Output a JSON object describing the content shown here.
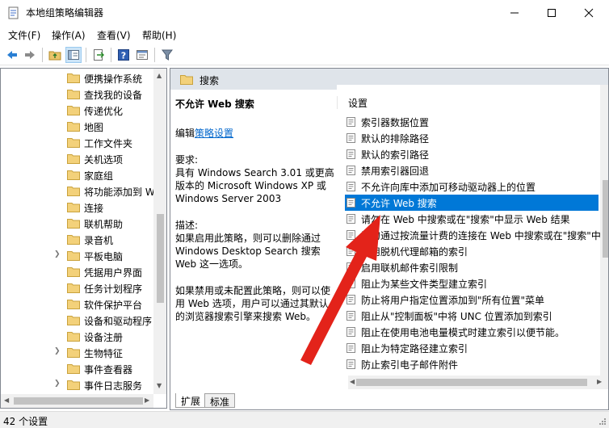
{
  "window": {
    "title": "本地组策略编辑器",
    "icon": "policy-editor-icon",
    "controls": [
      "minimize-icon",
      "maximize-icon",
      "close-icon"
    ]
  },
  "menu": [
    "文件(F)",
    "操作(A)",
    "查看(V)",
    "帮助(H)"
  ],
  "toolbar": [
    "back-arrow-icon",
    "forward-arrow-icon",
    "up-folder-icon",
    "show-hide-tree-icon",
    "export-list-icon",
    "help-icon",
    "properties-icon",
    "filter-icon"
  ],
  "tree": {
    "items": [
      {
        "label": "便携操作系统",
        "expandable": false
      },
      {
        "label": "查找我的设备",
        "expandable": false
      },
      {
        "label": "传递优化",
        "expandable": false
      },
      {
        "label": "地图",
        "expandable": false
      },
      {
        "label": "工作文件夹",
        "expandable": false
      },
      {
        "label": "关机选项",
        "expandable": false
      },
      {
        "label": "家庭组",
        "expandable": false
      },
      {
        "label": "将功能添加到 W",
        "expandable": false
      },
      {
        "label": "连接",
        "expandable": false
      },
      {
        "label": "联机帮助",
        "expandable": false
      },
      {
        "label": "录音机",
        "expandable": false
      },
      {
        "label": "平板电脑",
        "expandable": true
      },
      {
        "label": "凭据用户界面",
        "expandable": false
      },
      {
        "label": "任务计划程序",
        "expandable": false
      },
      {
        "label": "软件保护平台",
        "expandable": false
      },
      {
        "label": "设备和驱动程序",
        "expandable": false
      },
      {
        "label": "设备注册",
        "expandable": false
      },
      {
        "label": "生物特征",
        "expandable": true
      },
      {
        "label": "事件查看器",
        "expandable": false
      },
      {
        "label": "事件日志服务",
        "expandable": true
      }
    ]
  },
  "right": {
    "header": "搜索",
    "description": {
      "title": "不允许 Web 搜索",
      "edit_prefix": "编辑",
      "edit_link": "策略设置",
      "requirements_label": "要求:",
      "requirements": "具有 Windows Search 3.01 或更高版本的 Microsoft Windows XP 或 Windows Server 2003",
      "desc_label": "描述:",
      "desc1": "如果启用此策略，则可以删除通过 Windows Desktop Search 搜索 Web 这一选项。",
      "desc2": "如果禁用或未配置此策略，则可以使用 Web 选项，用户可以通过其默认的浏览器搜索引擎来搜索 Web。"
    },
    "column_header": "设置",
    "settings": [
      {
        "label": "索引器数据位置",
        "selected": false
      },
      {
        "label": "默认的排除路径",
        "selected": false
      },
      {
        "label": "默认的索引路径",
        "selected": false
      },
      {
        "label": "禁用索引器回退",
        "selected": false
      },
      {
        "label": "不允许向库中添加可移动驱动器上的位置",
        "selected": false
      },
      {
        "label": "不允许 Web 搜索",
        "selected": true
      },
      {
        "label": "请勿在 Web 中搜索或在\"搜索\"中显示 Web 结果",
        "selected": false
      },
      {
        "label": "请勿通过按流量计费的连接在 Web 中搜索或在\"搜索\"中",
        "selected": false
      },
      {
        "label": "启用脱机代理邮箱的索引",
        "selected": false
      },
      {
        "label": "启用联机邮件索引限制",
        "selected": false
      },
      {
        "label": "阻止为某些文件类型建立索引",
        "selected": false
      },
      {
        "label": "防止将用户指定位置添加到\"所有位置\"菜单",
        "selected": false
      },
      {
        "label": "阻止从\"控制面板\"中将 UNC 位置添加到索引",
        "selected": false
      },
      {
        "label": "阻止在使用电池电量模式时建立索引以便节能。",
        "selected": false
      },
      {
        "label": "阻止为特定路径建立索引",
        "selected": false
      },
      {
        "label": "防止索引电子邮件附件",
        "selected": false
      }
    ],
    "tabs": [
      "扩展",
      "标准"
    ]
  },
  "status": "42 个设置",
  "colors": {
    "selection": "#0078d7",
    "link": "#0066cc",
    "header_bg": "#dfe4ea",
    "annotation_arrow": "#e3231a"
  }
}
